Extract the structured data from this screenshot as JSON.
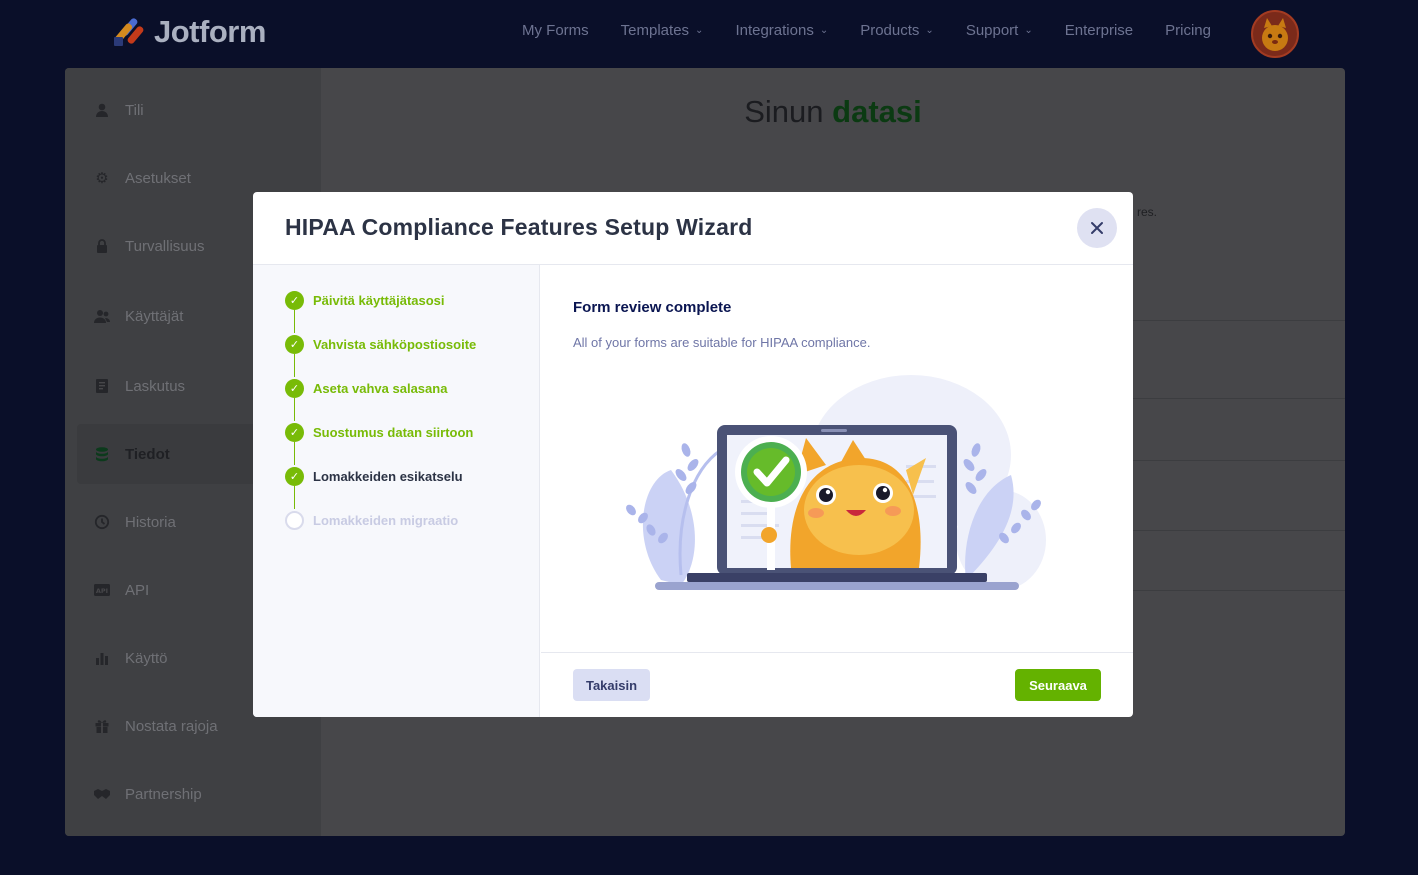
{
  "brand": {
    "name": "Jotform"
  },
  "nav": {
    "items": [
      {
        "label": "My Forms",
        "dropdown": false
      },
      {
        "label": "Templates",
        "dropdown": true
      },
      {
        "label": "Integrations",
        "dropdown": true
      },
      {
        "label": "Products",
        "dropdown": true
      },
      {
        "label": "Support",
        "dropdown": true
      },
      {
        "label": "Enterprise",
        "dropdown": false
      },
      {
        "label": "Pricing",
        "dropdown": false
      }
    ]
  },
  "sidebar": {
    "items": [
      {
        "label": "Tili",
        "icon": "user-icon",
        "active": false
      },
      {
        "label": "Asetukset",
        "icon": "gear-icon",
        "active": false
      },
      {
        "label": "Turvallisuus",
        "icon": "lock-icon",
        "active": false
      },
      {
        "label": "Käyttäjät",
        "icon": "users-icon",
        "active": false
      },
      {
        "label": "Laskutus",
        "icon": "invoice-icon",
        "active": false
      },
      {
        "label": "Tiedot",
        "icon": "database-icon",
        "active": true
      },
      {
        "label": "Historia",
        "icon": "history-icon",
        "active": false
      },
      {
        "label": "API",
        "icon": "api-icon",
        "active": false
      },
      {
        "label": "Käyttö",
        "icon": "bar-chart-icon",
        "active": false
      },
      {
        "label": "Nostata rajoja",
        "icon": "gift-icon",
        "active": false
      },
      {
        "label": "Partnership",
        "icon": "handshake-icon",
        "active": false
      }
    ]
  },
  "main": {
    "title_prefix": "Sinun",
    "title_highlight": "datasi",
    "fragment_text": "res."
  },
  "modal": {
    "title": "HIPAA Compliance Features Setup Wizard",
    "steps": [
      {
        "label": "Päivitä käyttäjätasosi",
        "state": "done"
      },
      {
        "label": "Vahvista sähköpostiosoite",
        "state": "done"
      },
      {
        "label": "Aseta vahva salasana",
        "state": "done"
      },
      {
        "label": "Suostumus datan siirtoon",
        "state": "done"
      },
      {
        "label": "Lomakkeiden esikatselu",
        "state": "current"
      },
      {
        "label": "Lomakkeiden migraatio",
        "state": "todo"
      }
    ],
    "content_title": "Form review complete",
    "content_desc": "All of your forms are suitable for HIPAA compliance.",
    "back_label": "Takaisin",
    "next_label": "Seuraava"
  },
  "colors": {
    "accent_green": "#78bb07",
    "next_button": "#64b200",
    "navy": "#0a1551"
  }
}
